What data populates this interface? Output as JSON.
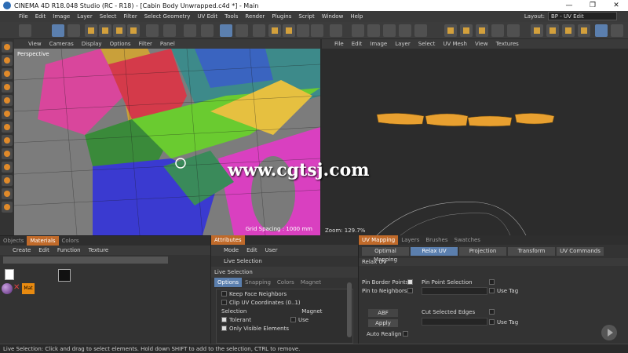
{
  "window": {
    "title": "CINEMA 4D R18.048 Studio (RC - R18) - [Cabin Body Unwrapped.c4d *] - Main",
    "controls": [
      "—",
      "❐",
      "✕"
    ]
  },
  "menubar": {
    "items": [
      "File",
      "Edit",
      "Image",
      "Layer",
      "Select",
      "Filter",
      "Select Geometry",
      "UV Edit",
      "Tools",
      "Render",
      "Plugins",
      "Script",
      "Window",
      "Help"
    ],
    "layout_label": "Layout:",
    "layout_value": "BP - UV Edit"
  },
  "viewport": {
    "menu": [
      "View",
      "Cameras",
      "Display",
      "Options",
      "Filter",
      "Panel"
    ],
    "label": "Perspective",
    "grid_spacing": "Grid Spacing : 1000 mm"
  },
  "uv_view": {
    "menu": [
      "File",
      "Edit",
      "Image",
      "Layer",
      "Select",
      "UV Mesh",
      "View",
      "Textures"
    ],
    "zoom": "Zoom: 129.7%"
  },
  "watermark": "www.cgtsj.com",
  "objects_panel": {
    "tabs": [
      "Objects",
      "Materials",
      "Colors"
    ],
    "active_tab": "Materials",
    "menu": [
      "Create",
      "Edit",
      "Function",
      "Texture"
    ],
    "material_label": "Mat"
  },
  "attributes": {
    "tab": "Attributes",
    "menu": [
      "Mode",
      "Edit",
      "User"
    ],
    "tool_title": "Live Selection",
    "section": "Live Selection",
    "sub_tabs": [
      "Options",
      "Snapping",
      "Colors",
      "Magnet"
    ],
    "options": {
      "keep_face_neighbors": "Keep Face Neighbors",
      "clip_uv": "Clip UV Coordinates (0..1)",
      "selection_label": "Selection",
      "tolerant": "Tolerant",
      "only_visible": "Only Visible Elements",
      "magnet_label": "Magnet",
      "use": "Use"
    }
  },
  "uv_mapping": {
    "tabs": [
      "UV Mapping",
      "Layers",
      "Brushes",
      "Swatches"
    ],
    "buttons": [
      "Optimal Mapping",
      "Relax UV",
      "Projection",
      "Transform",
      "UV Commands"
    ],
    "active_button": "Relax UV",
    "section": "Relax UV",
    "pin_border": "Pin Border Points",
    "pin_neighbors": "Pin to Neighbors",
    "pin_point": "Pin Point Selection",
    "use_tag_1": "Use Tag",
    "method": "ABF",
    "apply": "Apply",
    "auto_realign": "Auto Realign",
    "cut_edges": "Cut Selected Edges",
    "use_tag_2": "Use Tag"
  },
  "status": {
    "text": "Live Selection: Click and drag to select elements. Hold down SHIFT to add to the selection, CTRL to remove."
  },
  "colors": {
    "accent_orange": "#c06a2a",
    "active_blue": "#5b7fae"
  }
}
